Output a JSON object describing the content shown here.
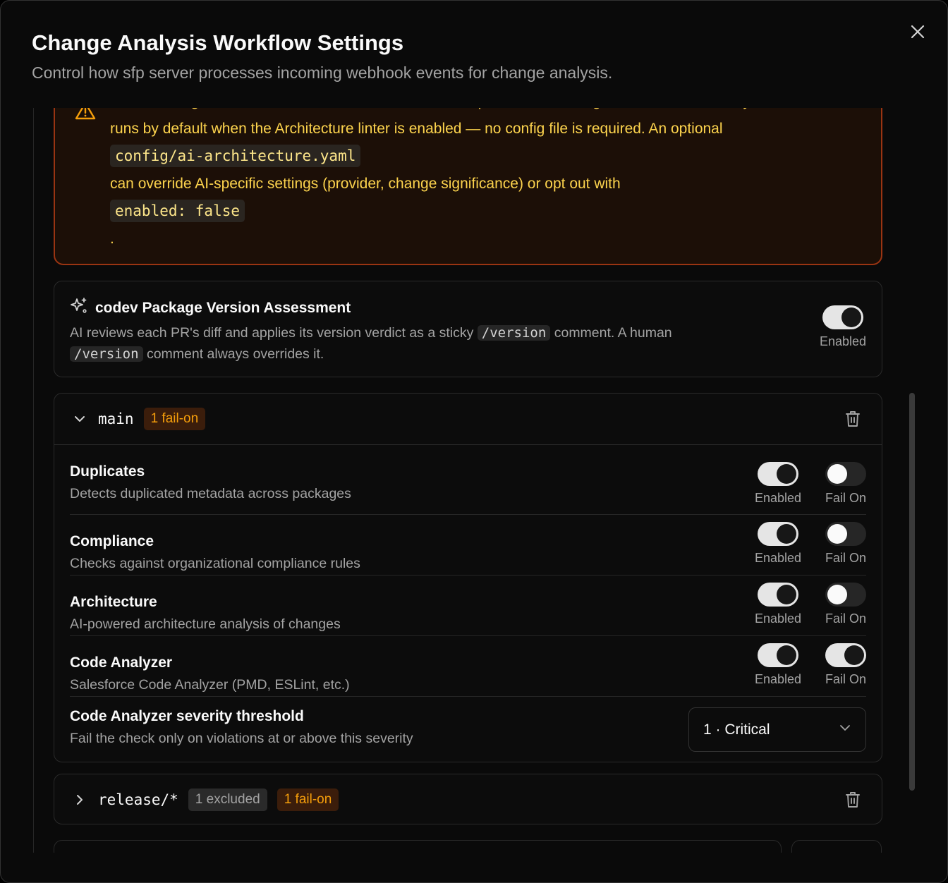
{
  "dialog": {
    "title": "Change Analysis Workflow Settings",
    "subtitle": "Control how sfp server processes incoming webhook events for change analysis.",
    "close_icon": "close-icon"
  },
  "warning": {
    "line1": "These settings control linter exclusions and fail-on rules passed as CLI flags. AI architecture analysis",
    "line2": "runs by default when the Architecture linter is enabled — no config file is required. An optional",
    "code1": "config/ai-architecture.yaml",
    "line3": "can override AI-specific settings (provider, change significance) or opt out with",
    "code2": "enabled: false",
    "line4": ".",
    "icon": "warning-triangle-icon",
    "accent": "#fcd34d"
  },
  "codev": {
    "title": "codev Package Version Assessment",
    "desc_part1": "AI reviews each PR's diff and applies its version verdict as a sticky",
    "code": "/version",
    "desc_part2": "comment. A human",
    "desc_part3": "comment always overrides it.",
    "toggle_label": "Enabled",
    "enabled": true,
    "icon": "sparkles-icon"
  },
  "branches": [
    {
      "name": "main",
      "badges": {
        "fail_on": "1 fail-on"
      },
      "expanded": true,
      "rules": [
        {
          "name": "Duplicates",
          "desc": "Detects duplicated metadata across packages",
          "enabled": true,
          "fail_on": false,
          "enabled_label": "Enabled",
          "fail_label": "Fail On"
        },
        {
          "name": "Compliance",
          "desc": "Checks against organizational compliance rules",
          "enabled": true,
          "fail_on": false,
          "enabled_label": "Enabled",
          "fail_label": "Fail On"
        },
        {
          "name": "Architecture",
          "desc": "AI-powered architecture analysis of changes",
          "enabled": true,
          "fail_on": false,
          "enabled_label": "Enabled",
          "fail_label": "Fail On"
        },
        {
          "name": "Code Analyzer",
          "desc": "Salesforce Code Analyzer (PMD, ESLint, etc.)",
          "enabled": true,
          "fail_on": true,
          "enabled_label": "Enabled",
          "fail_label": "Fail On"
        }
      ],
      "threshold": {
        "name": "Code Analyzer severity threshold",
        "desc": "Fail the check only on violations at or above this severity",
        "value": "1 · Critical"
      }
    },
    {
      "name": "release/*",
      "badges": {
        "excluded": "1 excluded",
        "fail_on": "1 fail-on"
      },
      "expanded": false
    }
  ],
  "colors": {
    "fail_badge": "#f59e0b",
    "warning_border": "#9a3412"
  }
}
